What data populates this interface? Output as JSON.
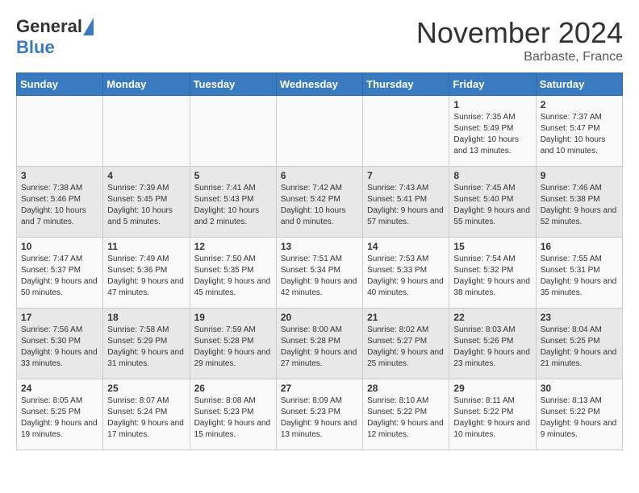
{
  "header": {
    "logo_line1": "General",
    "logo_line2": "Blue",
    "month": "November 2024",
    "location": "Barbaste, France"
  },
  "days_of_week": [
    "Sunday",
    "Monday",
    "Tuesday",
    "Wednesday",
    "Thursday",
    "Friday",
    "Saturday"
  ],
  "weeks": [
    [
      {
        "day": "",
        "info": ""
      },
      {
        "day": "",
        "info": ""
      },
      {
        "day": "",
        "info": ""
      },
      {
        "day": "",
        "info": ""
      },
      {
        "day": "",
        "info": ""
      },
      {
        "day": "1",
        "info": "Sunrise: 7:35 AM\nSunset: 5:49 PM\nDaylight: 10 hours and 13 minutes."
      },
      {
        "day": "2",
        "info": "Sunrise: 7:37 AM\nSunset: 5:47 PM\nDaylight: 10 hours and 10 minutes."
      }
    ],
    [
      {
        "day": "3",
        "info": "Sunrise: 7:38 AM\nSunset: 5:46 PM\nDaylight: 10 hours and 7 minutes."
      },
      {
        "day": "4",
        "info": "Sunrise: 7:39 AM\nSunset: 5:45 PM\nDaylight: 10 hours and 5 minutes."
      },
      {
        "day": "5",
        "info": "Sunrise: 7:41 AM\nSunset: 5:43 PM\nDaylight: 10 hours and 2 minutes."
      },
      {
        "day": "6",
        "info": "Sunrise: 7:42 AM\nSunset: 5:42 PM\nDaylight: 10 hours and 0 minutes."
      },
      {
        "day": "7",
        "info": "Sunrise: 7:43 AM\nSunset: 5:41 PM\nDaylight: 9 hours and 57 minutes."
      },
      {
        "day": "8",
        "info": "Sunrise: 7:45 AM\nSunset: 5:40 PM\nDaylight: 9 hours and 55 minutes."
      },
      {
        "day": "9",
        "info": "Sunrise: 7:46 AM\nSunset: 5:38 PM\nDaylight: 9 hours and 52 minutes."
      }
    ],
    [
      {
        "day": "10",
        "info": "Sunrise: 7:47 AM\nSunset: 5:37 PM\nDaylight: 9 hours and 50 minutes."
      },
      {
        "day": "11",
        "info": "Sunrise: 7:49 AM\nSunset: 5:36 PM\nDaylight: 9 hours and 47 minutes."
      },
      {
        "day": "12",
        "info": "Sunrise: 7:50 AM\nSunset: 5:35 PM\nDaylight: 9 hours and 45 minutes."
      },
      {
        "day": "13",
        "info": "Sunrise: 7:51 AM\nSunset: 5:34 PM\nDaylight: 9 hours and 42 minutes."
      },
      {
        "day": "14",
        "info": "Sunrise: 7:53 AM\nSunset: 5:33 PM\nDaylight: 9 hours and 40 minutes."
      },
      {
        "day": "15",
        "info": "Sunrise: 7:54 AM\nSunset: 5:32 PM\nDaylight: 9 hours and 38 minutes."
      },
      {
        "day": "16",
        "info": "Sunrise: 7:55 AM\nSunset: 5:31 PM\nDaylight: 9 hours and 35 minutes."
      }
    ],
    [
      {
        "day": "17",
        "info": "Sunrise: 7:56 AM\nSunset: 5:30 PM\nDaylight: 9 hours and 33 minutes."
      },
      {
        "day": "18",
        "info": "Sunrise: 7:58 AM\nSunset: 5:29 PM\nDaylight: 9 hours and 31 minutes."
      },
      {
        "day": "19",
        "info": "Sunrise: 7:59 AM\nSunset: 5:28 PM\nDaylight: 9 hours and 29 minutes."
      },
      {
        "day": "20",
        "info": "Sunrise: 8:00 AM\nSunset: 5:28 PM\nDaylight: 9 hours and 27 minutes."
      },
      {
        "day": "21",
        "info": "Sunrise: 8:02 AM\nSunset: 5:27 PM\nDaylight: 9 hours and 25 minutes."
      },
      {
        "day": "22",
        "info": "Sunrise: 8:03 AM\nSunset: 5:26 PM\nDaylight: 9 hours and 23 minutes."
      },
      {
        "day": "23",
        "info": "Sunrise: 8:04 AM\nSunset: 5:25 PM\nDaylight: 9 hours and 21 minutes."
      }
    ],
    [
      {
        "day": "24",
        "info": "Sunrise: 8:05 AM\nSunset: 5:25 PM\nDaylight: 9 hours and 19 minutes."
      },
      {
        "day": "25",
        "info": "Sunrise: 8:07 AM\nSunset: 5:24 PM\nDaylight: 9 hours and 17 minutes."
      },
      {
        "day": "26",
        "info": "Sunrise: 8:08 AM\nSunset: 5:23 PM\nDaylight: 9 hours and 15 minutes."
      },
      {
        "day": "27",
        "info": "Sunrise: 8:09 AM\nSunset: 5:23 PM\nDaylight: 9 hours and 13 minutes."
      },
      {
        "day": "28",
        "info": "Sunrise: 8:10 AM\nSunset: 5:22 PM\nDaylight: 9 hours and 12 minutes."
      },
      {
        "day": "29",
        "info": "Sunrise: 8:11 AM\nSunset: 5:22 PM\nDaylight: 9 hours and 10 minutes."
      },
      {
        "day": "30",
        "info": "Sunrise: 8:13 AM\nSunset: 5:22 PM\nDaylight: 9 hours and 9 minutes."
      }
    ]
  ]
}
